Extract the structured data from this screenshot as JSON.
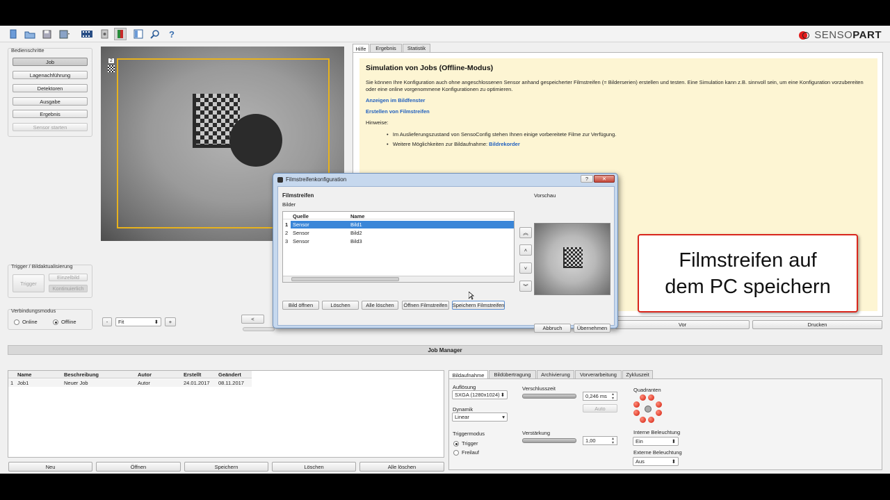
{
  "toolbar": {
    "icons": [
      "new-icon",
      "open-icon",
      "save-icon",
      "save-as-icon",
      "filmstrip-icon",
      "sensor-icon",
      "trigger-icon",
      "layout-icon",
      "search-icon",
      "help-icon"
    ]
  },
  "brand": {
    "logo_text_a": "SENSO",
    "logo_text_b": "PART"
  },
  "steps": {
    "title": "Bedienschritte",
    "items": [
      "Job",
      "Lagenachführung",
      "Detektoren",
      "Ausgabe",
      "Ergebnis",
      "Sensor starten"
    ]
  },
  "image": {
    "number": "2"
  },
  "trigger": {
    "title": "Trigger / Bildaktualisierung",
    "trigger_label": "Trigger",
    "single_label": "Einzelbild",
    "continuous_label": "Kontinuierlich"
  },
  "connection": {
    "title": "Verbindungsmodus",
    "online": "Online",
    "offline": "Offline"
  },
  "zoom": {
    "minus": "-",
    "value": "Fit",
    "plus": "+",
    "prev": "<"
  },
  "right_tabs": [
    "Hilfe",
    "Ergebnis",
    "Statistik"
  ],
  "help": {
    "title": "Simulation von Jobs (Offline-Modus)",
    "intro": "Sie können Ihre Konfiguration auch ohne angeschlossenen Sensor anhand gespeicherter Filmstreifen (= Bilderserien) erstellen und testen. Eine Simulation kann z.B. sinnvoll sein, um eine Konfiguration vorzubereiten oder eine online vorgenommene Konfigurationen zu optimieren.",
    "link1": "Anzeigen im Bildfenster",
    "link2": "Erstellen von Filmstreifen",
    "hints_label": "Hinweise:",
    "bullet1": "Im Auslieferungszustand von SensoConfig stehen Ihnen einige vorbereitete Filme zur Verfügung.",
    "bullet2_pre": "Weitere Möglichkeiten zur Bildaufnahme: ",
    "bullet2_link": "Bildrekorder"
  },
  "nav": {
    "fwd": "Vor",
    "print": "Drucken"
  },
  "callout": {
    "line1": "Filmstreifen auf",
    "line2": "dem PC speichern"
  },
  "job_manager": {
    "title": "Job Manager",
    "columns": [
      "Name",
      "Beschreibung",
      "Autor",
      "Erstellt",
      "Geändert"
    ],
    "rows": [
      {
        "idx": "1",
        "name": "Job1",
        "desc": "Neuer Job",
        "author": "Autor",
        "created": "24.01.2017",
        "changed": "08.11.2017"
      }
    ],
    "buttons": [
      "Neu",
      "Öffnen",
      "Speichern",
      "Löschen",
      "Alle löschen"
    ]
  },
  "capture_tabs": [
    "Bildaufnahme",
    "Bildübertragung",
    "Archivierung",
    "Vorverarbeitung",
    "Zykluszeit"
  ],
  "capture": {
    "resolution_label": "Auflösung",
    "resolution_value": "SXGA (1280x1024)",
    "dynamic_label": "Dynamik",
    "dynamic_value": "Linear",
    "trigger_mode_label": "Triggermodus",
    "trigger_opt": "Trigger",
    "free_opt": "Freilauf",
    "shutter_label": "Verschlusszeit",
    "shutter_value": "0,246 ms",
    "auto_label": "Auto",
    "gain_label": "Verstärkung",
    "gain_value": "1,00",
    "quadrants_label": "Quadranten",
    "internal_light_label": "Interne Beleuchtung",
    "internal_light_value": "Ein",
    "external_light_label": "Externe Beleuchtung",
    "external_light_value": "Aus"
  },
  "dialog": {
    "title": "Filmstreifenkonfiguration",
    "help_btn": "?",
    "close_btn": "✕",
    "heading": "Filmstreifen",
    "sub": "Bilder",
    "preview": "Vorschau",
    "columns": [
      "Quelle",
      "Name"
    ],
    "rows": [
      {
        "idx": "1",
        "src": "Sensor",
        "name": "Bild1"
      },
      {
        "idx": "2",
        "src": "Sensor",
        "name": "Bild2"
      },
      {
        "idx": "3",
        "src": "Sensor",
        "name": "Bild3"
      }
    ],
    "buttons": [
      "Bild öffnen",
      "Löschen",
      "Alle löschen",
      "Öffnen Filmstreifen",
      "Speichern Filmstreifen"
    ],
    "cancel": "Abbruch",
    "apply": "Übernehmen"
  }
}
